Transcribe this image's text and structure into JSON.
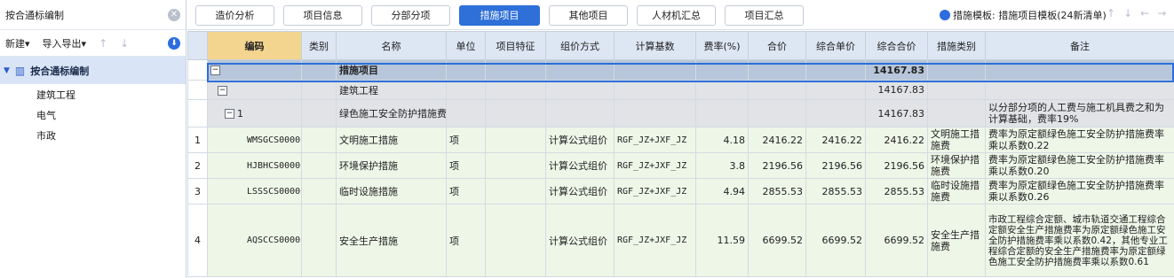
{
  "left": {
    "title": "按合通标编制",
    "tools": [
      "新建",
      "导入导出"
    ],
    "tree_root": "按合通标编制",
    "tree_children": [
      "建筑工程",
      "电气",
      "市政"
    ]
  },
  "tabs": [
    "造价分析",
    "项目信息",
    "分部分项",
    "措施项目",
    "其他项目",
    "人材机汇总",
    "项目汇总"
  ],
  "active_tab": "措施项目",
  "template_label": "措施模板: 措施项目模板(24新清单)",
  "columns": [
    "编码",
    "类别",
    "名称",
    "单位",
    "项目特征",
    "组价方式",
    "计算基数",
    "费率(%)",
    "合价",
    "综合单价",
    "综合合价",
    "措施类别",
    "备注"
  ],
  "rows": [
    {
      "idx": "",
      "code": "",
      "name": "措施项目",
      "total": "14167.83",
      "kind": "sum"
    },
    {
      "idx": "",
      "code": "",
      "name": "建筑工程",
      "total": "14167.83",
      "kind": "grp"
    },
    {
      "idx": "",
      "code": "1",
      "name": "绿色施工安全防护措施费",
      "total": "14167.83",
      "remark": "以分部分项的人工费与施工机具费之和为计算基础，费率19%",
      "kind": "sub"
    },
    {
      "idx": "1",
      "code": "WMSGCS000001",
      "name": "文明施工措施",
      "unit": "项",
      "method": "计算公式组价",
      "base": "RGF_JZ+JXF_JZ",
      "rate": "4.18",
      "amount": "2416.22",
      "unit_price": "2416.22",
      "total": "2416.22",
      "cat": "文明施工措施费",
      "remark": "费率为原定额绿色施工安全防护措施费率乘以系数0.22",
      "kind": "item"
    },
    {
      "idx": "2",
      "code": "HJBHCS000001",
      "name": "环境保护措施",
      "unit": "项",
      "method": "计算公式组价",
      "base": "RGF_JZ+JXF_JZ",
      "rate": "3.8",
      "amount": "2196.56",
      "unit_price": "2196.56",
      "total": "2196.56",
      "cat": "环境保护措施费",
      "remark": "费率为原定额绿色施工安全防护措施费率乘以系数0.20",
      "kind": "item"
    },
    {
      "idx": "3",
      "code": "LSSSCS000001",
      "name": "临时设施措施",
      "unit": "项",
      "method": "计算公式组价",
      "base": "RGF_JZ+JXF_JZ",
      "rate": "4.94",
      "amount": "2855.53",
      "unit_price": "2855.53",
      "total": "2855.53",
      "cat": "临时设施措施费",
      "remark": "费率为原定额绿色施工安全防护措施费率乘以系数0.26",
      "kind": "item"
    },
    {
      "idx": "4",
      "code": "AQSCCS000001",
      "name": "安全生产措施",
      "unit": "项",
      "method": "计算公式组价",
      "base": "RGF_JZ+JXF_JZ",
      "rate": "11.59",
      "amount": "6699.52",
      "unit_price": "6699.52",
      "total": "6699.52",
      "cat": "安全生产措施费",
      "remark": "市政工程综合定额、城市轨道交通工程综合定额安全生产措施费率为原定额绿色施工安全防护措施费率乘以系数0.42，其他专业工程综合定额的安全生产措施费率为原定额绿色施工安全防护措施费率乘以系数0.61",
      "kind": "big"
    }
  ]
}
